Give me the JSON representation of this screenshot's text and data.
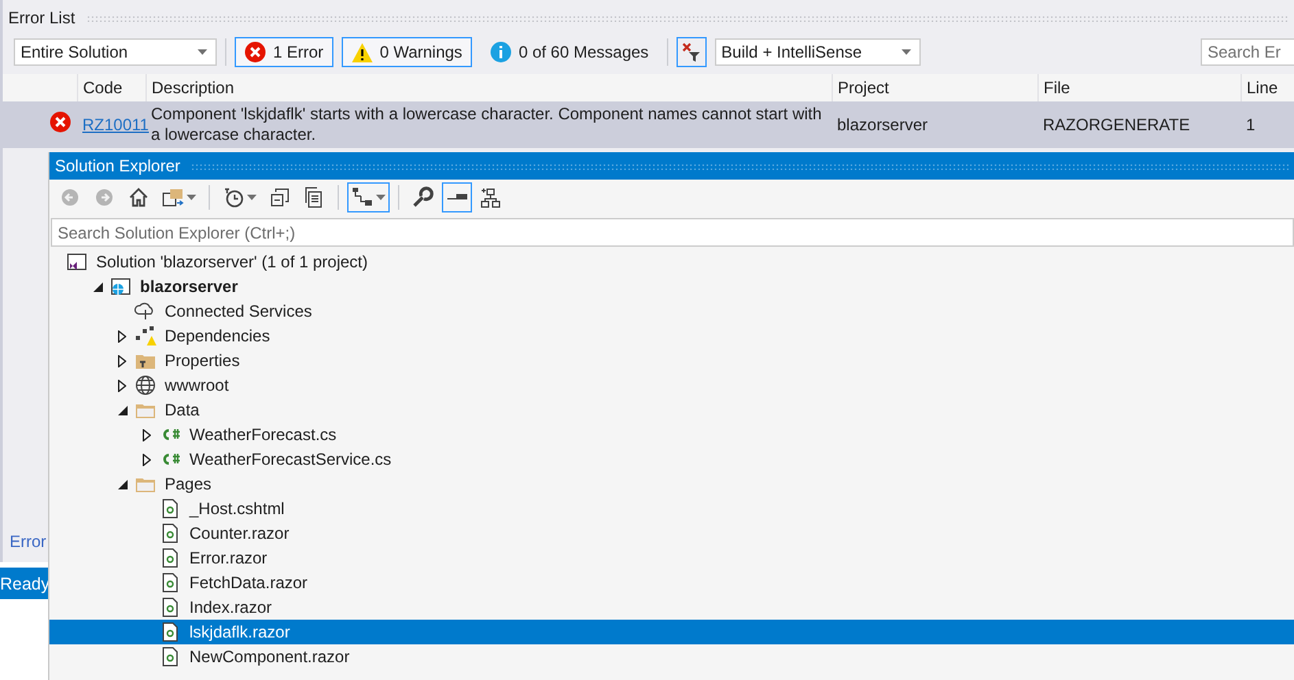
{
  "error_list": {
    "title": "Error List",
    "scope": {
      "value": "Entire Solution"
    },
    "filters": [
      {
        "kind": "error",
        "label": "1 Error",
        "selected": true
      },
      {
        "kind": "warning",
        "label": "0 Warnings",
        "selected": true
      },
      {
        "kind": "message",
        "label": "0 of 60 Messages",
        "selected": false
      }
    ],
    "source": {
      "value": "Build + IntelliSense"
    },
    "search": {
      "placeholder": "Search Er"
    },
    "table": {
      "columns": [
        "Code",
        "Description",
        "Project",
        "File",
        "Line"
      ],
      "rows": [
        {
          "kind": "error",
          "selected": true,
          "code": "RZ10011",
          "description": "Component 'lskjdaflk' starts with a lowercase character. Component names cannot start with a lowercase character.",
          "project": "blazorserver",
          "file": "RAZORGENERATE",
          "line": "1"
        }
      ]
    },
    "bottom_tab": "Error"
  },
  "status_bar": {
    "text": "Ready"
  },
  "solution_explorer": {
    "title": "Solution Explorer",
    "toolbar": [
      {
        "kind": "back",
        "disabled": true
      },
      {
        "kind": "forward",
        "disabled": true
      },
      {
        "kind": "home",
        "disabled": false
      },
      {
        "kind": "switch-views",
        "disabled": false,
        "dropdown": true
      },
      {
        "kind": "separator"
      },
      {
        "kind": "pending-changes",
        "disabled": false,
        "dropdown": true
      },
      {
        "kind": "collapse-all",
        "disabled": false
      },
      {
        "kind": "show-all-files",
        "disabled": false
      },
      {
        "kind": "separator"
      },
      {
        "kind": "sync",
        "disabled": false,
        "on": true,
        "dropdown": true
      },
      {
        "kind": "separator"
      },
      {
        "kind": "properties",
        "disabled": false
      },
      {
        "kind": "preview",
        "disabled": false,
        "on": true
      },
      {
        "kind": "class-diagram",
        "disabled": false
      }
    ],
    "search": {
      "placeholder": "Search Solution Explorer (Ctrl+;)"
    },
    "tree": [
      {
        "kind": "solution",
        "label": "Solution 'blazorserver' (1 of 1 project)",
        "selected": false,
        "children": [
          {
            "kind": "project",
            "label": "blazorserver",
            "selected": false,
            "expanded": true,
            "children": [
              {
                "kind": "connected",
                "label": "Connected Services",
                "selected": false
              },
              {
                "kind": "dependencies",
                "label": "Dependencies",
                "selected": false,
                "expanded": false
              },
              {
                "kind": "properties",
                "label": "Properties",
                "selected": false,
                "expanded": false
              },
              {
                "kind": "web",
                "label": "wwwroot",
                "selected": false,
                "expanded": false
              },
              {
                "kind": "folder",
                "label": "Data",
                "selected": false,
                "expanded": true,
                "children": [
                  {
                    "kind": "csharp",
                    "label": "WeatherForecast.cs",
                    "selected": false,
                    "expanded": false
                  },
                  {
                    "kind": "csharp",
                    "label": "WeatherForecastService.cs",
                    "selected": false,
                    "expanded": false
                  }
                ]
              },
              {
                "kind": "folder",
                "label": "Pages",
                "selected": false,
                "expanded": true,
                "children": [
                  {
                    "kind": "razor",
                    "label": "_Host.cshtml",
                    "selected": false
                  },
                  {
                    "kind": "razor",
                    "label": "Counter.razor",
                    "selected": false
                  },
                  {
                    "kind": "razor",
                    "label": "Error.razor",
                    "selected": false
                  },
                  {
                    "kind": "razor",
                    "label": "FetchData.razor",
                    "selected": false
                  },
                  {
                    "kind": "razor",
                    "label": "Index.razor",
                    "selected": false
                  },
                  {
                    "kind": "razor",
                    "label": "lskjdaflk.razor",
                    "selected": true
                  },
                  {
                    "kind": "razor",
                    "label": "NewComponent.razor",
                    "selected": false
                  }
                ]
              }
            ]
          }
        ]
      }
    ]
  }
}
